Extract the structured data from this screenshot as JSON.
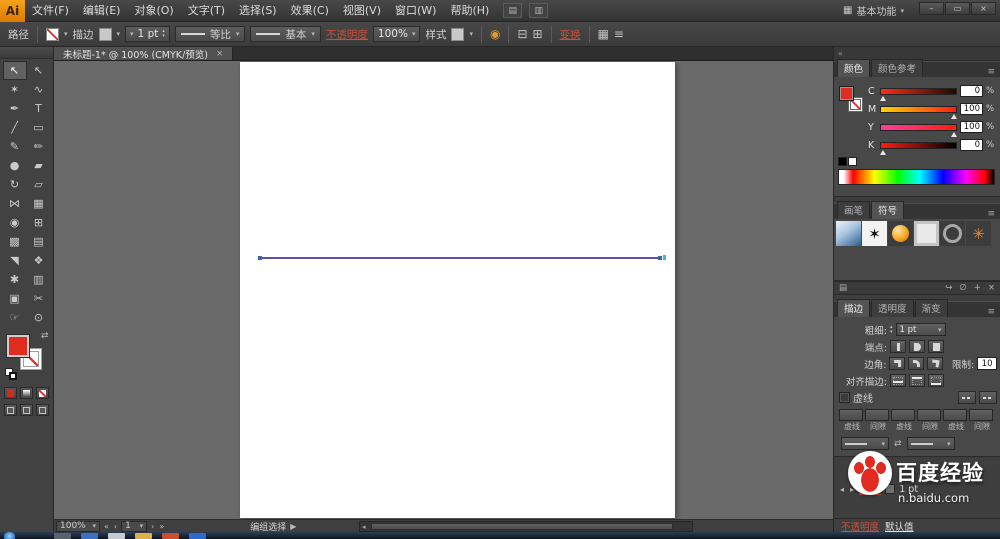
{
  "titlebar": {
    "logo": "Ai",
    "menus": [
      "文件(F)",
      "编辑(E)",
      "对象(O)",
      "文字(T)",
      "选择(S)",
      "效果(C)",
      "视图(V)",
      "窗口(W)",
      "帮助(H)"
    ],
    "workspace": "基本功能"
  },
  "control_bar": {
    "context": "路径",
    "stroke_label": "描边",
    "weight": "1 pt",
    "profile": "等比",
    "brush": "基本",
    "opacity_label": "不透明度",
    "opacity_value": "100%",
    "style_label": "样式",
    "transform_label": "变换"
  },
  "document_tab": {
    "title": "未标题-1* @ 100% (CMYK/预览)",
    "close": "×"
  },
  "tools": [
    {
      "name": "selection-tool",
      "glyph": "↖"
    },
    {
      "name": "direct-selection-tool",
      "glyph": "↖"
    },
    {
      "name": "magic-wand-tool",
      "glyph": "✶"
    },
    {
      "name": "lasso-tool",
      "glyph": "∿"
    },
    {
      "name": "pen-tool",
      "glyph": "✒"
    },
    {
      "name": "type-tool",
      "glyph": "T"
    },
    {
      "name": "line-segment-tool",
      "glyph": "╱"
    },
    {
      "name": "rectangle-tool",
      "glyph": "▭"
    },
    {
      "name": "paintbrush-tool",
      "glyph": "✎"
    },
    {
      "name": "pencil-tool",
      "glyph": "✏"
    },
    {
      "name": "blob-brush-tool",
      "glyph": "●"
    },
    {
      "name": "eraser-tool",
      "glyph": "▰"
    },
    {
      "name": "rotate-tool",
      "glyph": "↻"
    },
    {
      "name": "scale-tool",
      "glyph": "▱"
    },
    {
      "name": "width-tool",
      "glyph": "⋈"
    },
    {
      "name": "free-transform-tool",
      "glyph": "▦"
    },
    {
      "name": "shape-builder-tool",
      "glyph": "◉"
    },
    {
      "name": "perspective-grid-tool",
      "glyph": "⊞"
    },
    {
      "name": "mesh-tool",
      "glyph": "▩"
    },
    {
      "name": "gradient-tool",
      "glyph": "▤"
    },
    {
      "name": "eyedropper-tool",
      "glyph": "◥"
    },
    {
      "name": "blend-tool",
      "glyph": "❖"
    },
    {
      "name": "symbol-sprayer-tool",
      "glyph": "✱"
    },
    {
      "name": "column-graph-tool",
      "glyph": "▥"
    },
    {
      "name": "artboard-tool",
      "glyph": "▣"
    },
    {
      "name": "slice-tool",
      "glyph": "✂"
    },
    {
      "name": "hand-tool",
      "glyph": "☞"
    },
    {
      "name": "zoom-tool",
      "glyph": "⊙"
    }
  ],
  "panels": {
    "color": {
      "tabs": [
        "颜色",
        "颜色参考"
      ],
      "active_tab": "颜色",
      "unit": "%",
      "sliders": [
        {
          "channel": "C",
          "value": "0",
          "pos": 3,
          "from": "#ff2d16",
          "to": "#1c0b06"
        },
        {
          "channel": "M",
          "value": "100",
          "pos": 97,
          "from": "#ffd400",
          "to": "#ff1d0e"
        },
        {
          "channel": "Y",
          "value": "100",
          "pos": 97,
          "from": "#ff3d9e",
          "to": "#ff1d0e"
        },
        {
          "channel": "K",
          "value": "0",
          "pos": 3,
          "from": "#ff1d0e",
          "to": "#000000"
        }
      ]
    },
    "symbols": {
      "tabs": [
        "画笔",
        "符号"
      ],
      "active_tab": "符号",
      "items": [
        "symbol-gradient-square",
        "symbol-flower-silhouette",
        "symbol-orange-orb",
        "symbol-light-frame",
        "symbol-gear",
        "symbol-orange-flower"
      ],
      "footer_icons": [
        {
          "name": "symbol-libraries-icon",
          "glyph": "▤"
        },
        {
          "name": "place-symbol-icon",
          "glyph": "↪"
        },
        {
          "name": "break-link-icon",
          "glyph": "∅"
        },
        {
          "name": "new-symbol-icon",
          "glyph": "+"
        },
        {
          "name": "delete-symbol-icon",
          "glyph": "×"
        }
      ]
    },
    "stroke": {
      "tabs": [
        "描边",
        "透明度",
        "渐变"
      ],
      "active_tab": "描边",
      "weight_label": "粗细:",
      "weight_value": "1 pt",
      "cap_label": "端点:",
      "corner_label": "边角:",
      "limit_label": "限制:",
      "limit_value": "10",
      "align_label": "对齐描边:",
      "dashed_label": "虚线",
      "dash_field_labels": [
        "虚线",
        "间隙",
        "虚线",
        "间隙",
        "虚线",
        "间隙"
      ]
    },
    "appearance": {
      "stroke_label": "描边:",
      "stroke_value": "1 pt",
      "opacity_label": "不透明度",
      "opacity_value": "默认值"
    }
  },
  "status_bar": {
    "zoom": "100%",
    "artboard": "1",
    "tool_hint": "编组选择"
  },
  "watermark": {
    "brand": "百度经验",
    "url": "n.baidu.com"
  },
  "icons": {
    "dropdown": "▾",
    "up": "▴",
    "menu": "≡",
    "swap": "⇄",
    "minimize": "–",
    "restore": "▭",
    "close": "×",
    "first": "«",
    "prev": "‹",
    "next": "›",
    "last": "»",
    "expand": "▶",
    "scroll_left": "◂",
    "scroll_right": "▸",
    "color_wheel": "◉",
    "align_h": "⊟",
    "align_v": "⊞",
    "grid": "▦",
    "lines": "≡",
    "arrange_docs": "▤",
    "doc_layout": "▥"
  },
  "colors": {
    "accent_red": "#e02b20",
    "selection_line": "#5b4fae",
    "canvas": "#6a6a6a",
    "panel_dark": "#3e3e3e"
  },
  "taskbar": {
    "icons": [
      {
        "name": "taskbar-icon-1",
        "color": "#5b6770"
      },
      {
        "name": "taskbar-icon-2",
        "color": "#3f74c4"
      },
      {
        "name": "taskbar-icon-3",
        "color": "#cfd4da"
      },
      {
        "name": "taskbar-icon-4",
        "color": "#e8b84b"
      },
      {
        "name": "taskbar-icon-5",
        "color": "#d4502e"
      },
      {
        "name": "taskbar-icon-6",
        "color": "#2f6fd0"
      }
    ]
  }
}
